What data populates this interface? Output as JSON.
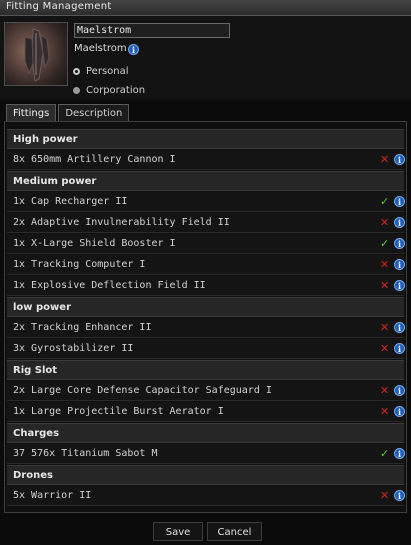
{
  "window": {
    "title": "Fitting Management"
  },
  "header": {
    "fitting_name_value": "Maelstrom",
    "ship_name": "Maelstrom",
    "visibility_options": [
      {
        "label": "Personal",
        "selected": true
      },
      {
        "label": "Corporation",
        "selected": false
      }
    ]
  },
  "tabs": [
    {
      "label": "Fittings",
      "active": true
    },
    {
      "label": "Description",
      "active": false
    }
  ],
  "groups": {
    "high_power": {
      "label": "High power",
      "items": [
        {
          "text": "8x 650mm Artillery Cannon I",
          "status": "✕"
        }
      ]
    },
    "medium_power": {
      "label": "Medium power",
      "items": [
        {
          "text": "1x Cap Recharger II",
          "status": "✓"
        },
        {
          "text": "2x Adaptive Invulnerability Field II",
          "status": "✕"
        },
        {
          "text": "1x X-Large Shield Booster I",
          "status": "✓"
        },
        {
          "text": "1x Tracking Computer I",
          "status": "✕"
        },
        {
          "text": "1x Explosive Deflection Field II",
          "status": "✕"
        }
      ]
    },
    "low_power": {
      "label": "low power",
      "items": [
        {
          "text": "2x Tracking Enhancer II",
          "status": "✕"
        },
        {
          "text": "3x Gyrostabilizer II",
          "status": "✕"
        }
      ]
    },
    "rig_slot": {
      "label": "Rig Slot",
      "items": [
        {
          "text": "2x Large Core Defense Capacitor Safeguard I",
          "status": "✕"
        },
        {
          "text": "1x Large Projectile Burst Aerator I",
          "status": "✕"
        }
      ]
    },
    "charges": {
      "label": "Charges",
      "items": [
        {
          "text": "37 576x Titanium Sabot M",
          "status": "✓"
        }
      ]
    },
    "drones": {
      "label": "Drones",
      "items": [
        {
          "text": "5x Warrior II",
          "status": "✕"
        }
      ]
    }
  },
  "footer": {
    "save_label": "Save",
    "cancel_label": "Cancel"
  },
  "colors": {
    "missing": "#d42222",
    "available": "#5cc42a",
    "info": "#1f5fb8"
  },
  "icons": {
    "info": "info-icon",
    "missing": "cross-icon",
    "available": "check-icon"
  }
}
